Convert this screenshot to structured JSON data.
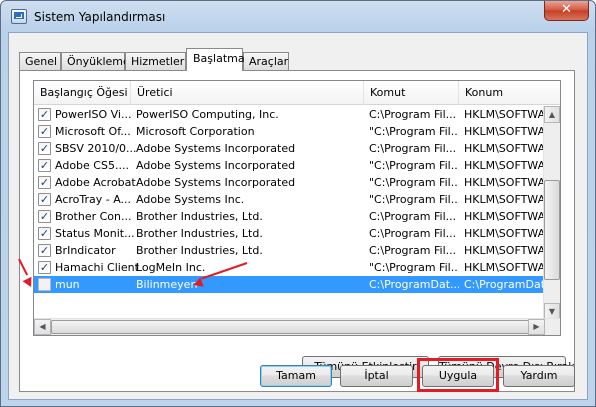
{
  "window": {
    "title": "Sistem Yapılandırması",
    "close_label": "✕"
  },
  "tabs": [
    "Genel",
    "Önyükleme",
    "Hizmetler",
    "Başlatma",
    "Araçlar"
  ],
  "active_tab": "Başlatma",
  "table": {
    "headers": [
      "Başlangıç Öğesi",
      "Üretici",
      "Komut",
      "Konum"
    ],
    "rows": [
      {
        "checked": true,
        "name": "PowerISO Vi...",
        "maker": "PowerISO Computing, Inc.",
        "command": "C:\\Program Fil...",
        "location": "HKLM\\SOFTWAR"
      },
      {
        "checked": true,
        "name": "Microsoft Of...",
        "maker": "Microsoft Corporation",
        "command": "\"C:\\Program Fil...",
        "location": "HKLM\\SOFTWAR"
      },
      {
        "checked": true,
        "name": "SBSV 2010/0...",
        "maker": "Adobe Systems Incorporated",
        "command": "C:\\Program Fil...",
        "location": "HKLM\\SOFTWAR"
      },
      {
        "checked": true,
        "name": "Adobe CS5....",
        "maker": "Adobe Systems Incorporated",
        "command": "\"C:\\Program Fil...",
        "location": "HKLM\\SOFTWAR"
      },
      {
        "checked": true,
        "name": "Adobe Acrobat",
        "maker": "Adobe Systems Incorporated",
        "command": "\"C:\\Program Fil...",
        "location": "HKLM\\SOFTWAR"
      },
      {
        "checked": true,
        "name": "AcroTray - A...",
        "maker": "Adobe Systems Inc.",
        "command": "\"C:\\Program Fil...",
        "location": "HKLM\\SOFTWAR"
      },
      {
        "checked": true,
        "name": "Brother Con...",
        "maker": "Brother Industries, Ltd.",
        "command": "C:\\Program Fil...",
        "location": "HKLM\\SOFTWAR"
      },
      {
        "checked": true,
        "name": "Status Monit...",
        "maker": "Brother Industries, Ltd.",
        "command": "C:\\Program Fil...",
        "location": "HKLM\\SOFTWAR"
      },
      {
        "checked": true,
        "name": "BrIndicator",
        "maker": "Brother Industries, Ltd.",
        "command": "C:\\Program Fil...",
        "location": "HKLM\\SOFTWAR"
      },
      {
        "checked": true,
        "name": "Hamachi Client",
        "maker": "LogMeIn Inc.",
        "command": "\"C:\\Program Fil...",
        "location": "HKLM\\SOFTWAR"
      },
      {
        "checked": false,
        "name": "mun",
        "maker": "Bilinmeyen",
        "command": "C:\\ProgramDat...",
        "location": "C:\\ProgramData",
        "selected": true
      }
    ]
  },
  "buttons": {
    "enable_all": "Tümünü Etkinleştir",
    "disable_all": "Tümünü Devre Dışı Bırak",
    "ok": "Tamam",
    "cancel": "İptal",
    "apply": "Uygula",
    "help": "Yardım"
  },
  "colors": {
    "selection": "#3399ff",
    "annotation": "#e11c26"
  }
}
